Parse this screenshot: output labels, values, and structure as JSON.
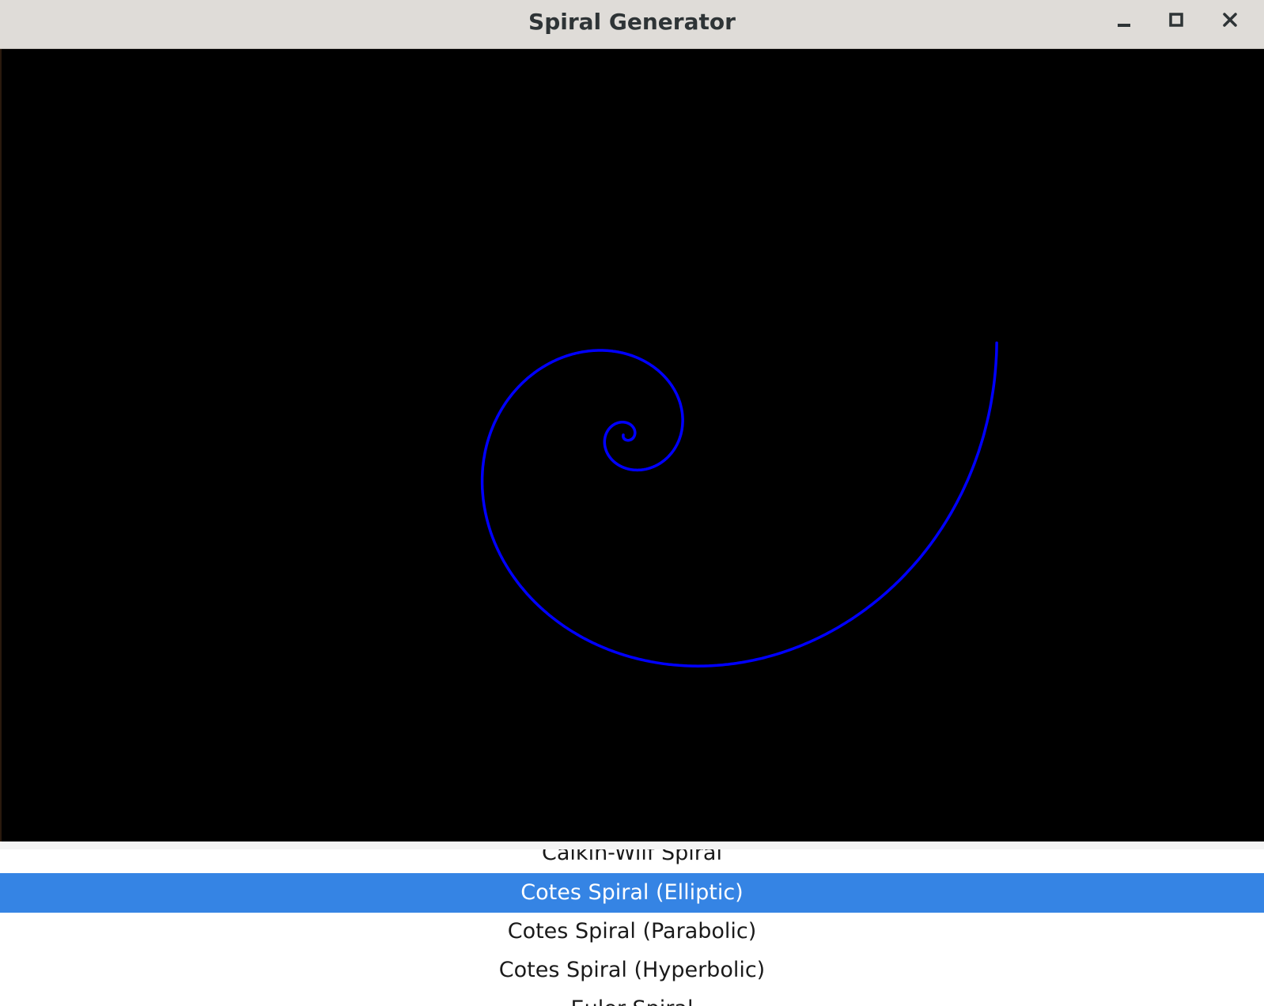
{
  "window": {
    "title": "Spiral Generator",
    "controls": {
      "minimize_icon": "minimize-icon",
      "maximize_icon": "maximize-icon",
      "close_icon": "close-icon"
    }
  },
  "canvas": {
    "background": "#000000",
    "spiral_color": "#0000ff",
    "spiral": "Cotes Spiral (Elliptic)"
  },
  "spiral_list": {
    "items": [
      "Calkin-Wilf Spiral",
      "Cotes Spiral (Elliptic)",
      "Cotes Spiral (Parabolic)",
      "Cotes Spiral (Hyperbolic)",
      "Euler Spiral"
    ],
    "selected": "Cotes Spiral (Elliptic)",
    "selected_color": "#3584e4"
  }
}
